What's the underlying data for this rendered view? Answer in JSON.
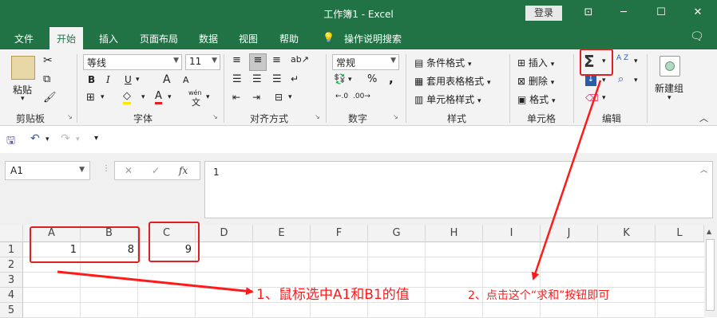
{
  "window": {
    "title": "工作簿1  -  Excel",
    "login": "登录"
  },
  "menu": {
    "items": [
      "文件",
      "开始",
      "插入",
      "页面布局",
      "数据",
      "视图",
      "帮助"
    ],
    "search": "操作说明搜索"
  },
  "clipboard": {
    "paste": "粘贴",
    "label": "剪贴板"
  },
  "font": {
    "name": "等线",
    "size": "11",
    "label": "字体",
    "bold": "B",
    "italic": "I",
    "underline": "U",
    "grow": "A",
    "shrink": "A",
    "color_letter": "A",
    "wen": "wén",
    "wen_char": "文"
  },
  "alignment": {
    "label": "对齐方式"
  },
  "number": {
    "format": "常规",
    "label": "数字",
    "percent": "%",
    "comma": ","
  },
  "styles": {
    "cond": "条件格式",
    "table": "套用表格格式",
    "cell": "单元格样式",
    "label": "样式"
  },
  "cells": {
    "insert": "插入",
    "delete": "删除",
    "format": "格式",
    "label": "单元格"
  },
  "editing": {
    "sum": "Σ",
    "label": "编辑",
    "sort": "A Z"
  },
  "newgroup": {
    "label": "新建组"
  },
  "formula": {
    "namebox": "A1",
    "content": "1",
    "fx": "fx",
    "cancel": "✕",
    "confirm": "✓"
  },
  "sheet": {
    "columns": [
      "A",
      "B",
      "C",
      "D",
      "E",
      "F",
      "G",
      "H",
      "I",
      "J",
      "K",
      "L"
    ],
    "rows": [
      "1",
      "2",
      "3",
      "4",
      "5"
    ],
    "cells": {
      "A1": "1",
      "B1": "8",
      "C1": "9"
    }
  },
  "annotations": {
    "step1": "1、鼠标选中A1和B1的值",
    "step2": "2、点击这个“求和”按钮即可"
  },
  "colors": {
    "accent": "#217346",
    "annotation": "#ff1a1a"
  }
}
